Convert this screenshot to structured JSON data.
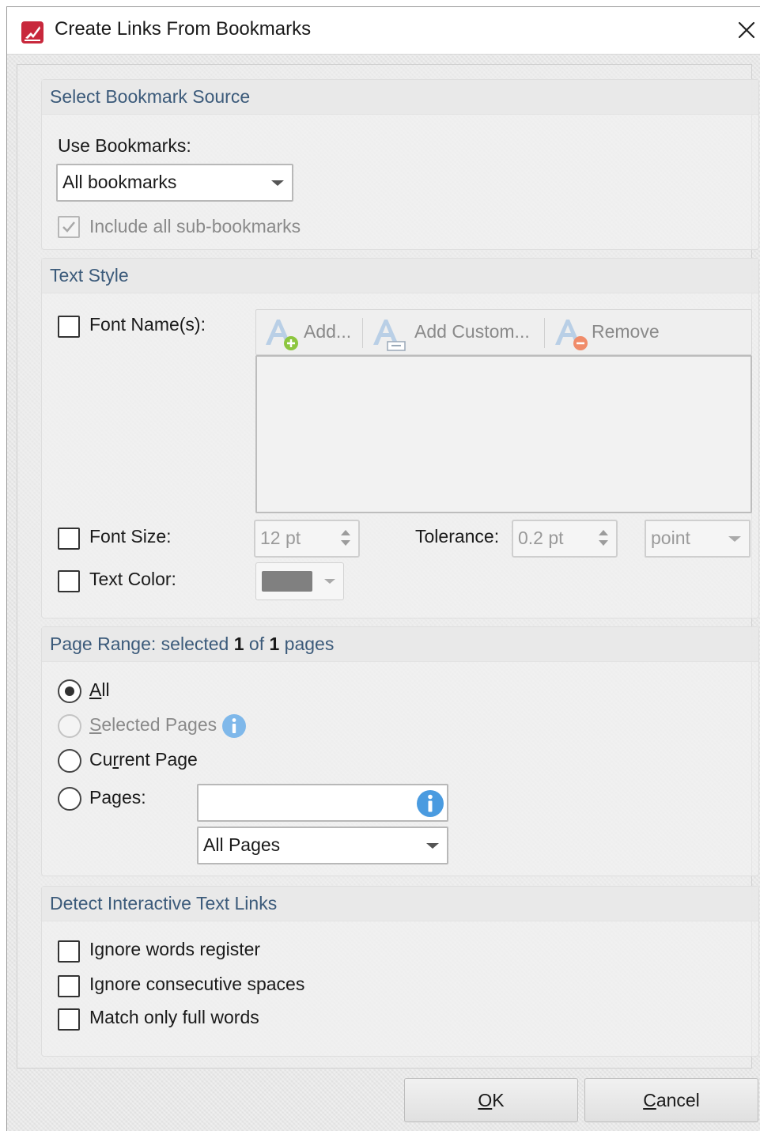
{
  "window": {
    "title": "Create Links From Bookmarks"
  },
  "bookmark_source": {
    "title": "Select Bookmark Source",
    "use_label": "Use Bookmarks:",
    "use_value": "All bookmarks",
    "include_sub": {
      "label": "Include all sub-bookmarks",
      "checked": true,
      "enabled": false
    }
  },
  "text_style": {
    "title": "Text Style",
    "font_names": {
      "label": "Font Name(s):",
      "checked": false
    },
    "toolbar": {
      "add": "Add...",
      "add_custom": "Add Custom...",
      "remove": "Remove"
    },
    "font_size": {
      "label": "Font Size:",
      "value": "12 pt",
      "checked": false
    },
    "tolerance": {
      "label": "Tolerance:",
      "value": "0.2 pt",
      "unit": "point"
    },
    "text_color": {
      "label": "Text Color:",
      "checked": false,
      "swatch": "#808080"
    }
  },
  "page_range": {
    "title_prefix": "Page Range: selected ",
    "selected": "1",
    "of_text": " of ",
    "total": "1",
    "pages_suffix": " pages",
    "options": {
      "all": {
        "first": "A",
        "rest": "ll",
        "selected": true
      },
      "selected_pages": {
        "first": "S",
        "rest": "elected Pages",
        "enabled": false
      },
      "current_page": {
        "before": "Cu",
        "accel": "r",
        "after": "rent Page"
      },
      "pages": {
        "before": "Pa",
        "accel": "g",
        "after": "es:"
      }
    },
    "pages_input_value": "",
    "subset": "All Pages"
  },
  "detect": {
    "title": "Detect Interactive Text Links",
    "ignore_register": "Ignore words register",
    "ignore_spaces": "Ignore consecutive spaces",
    "full_words": "Match only full words"
  },
  "buttons": {
    "ok": {
      "accel": "O",
      "rest": "K"
    },
    "cancel": {
      "accel": "C",
      "rest": "ancel"
    }
  },
  "colors": {
    "accent": "#3b5a7a",
    "info": "#4a9be0",
    "icon_red": "#c8283c"
  }
}
